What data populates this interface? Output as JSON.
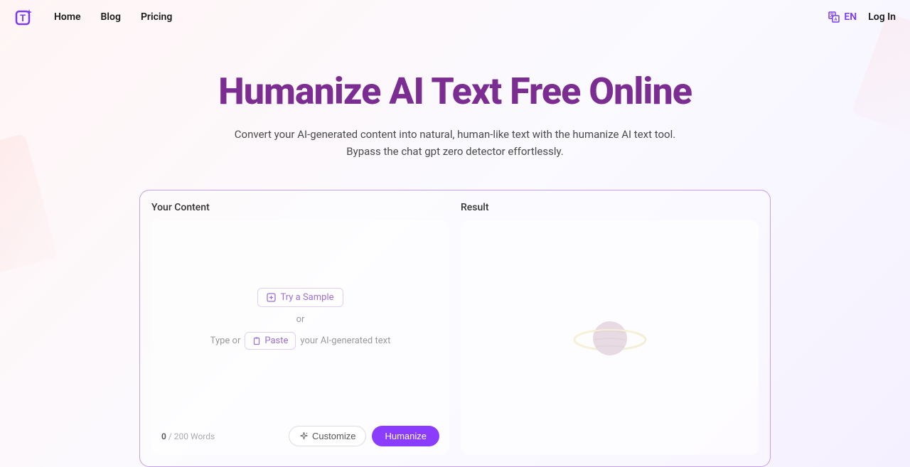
{
  "nav": {
    "home": "Home",
    "blog": "Blog",
    "pricing": "Pricing"
  },
  "header": {
    "lang": "EN",
    "login": "Log In"
  },
  "hero": {
    "title": "Humanize AI Text Free Online",
    "subtitle_line1": "Convert your AI-generated content into natural, human-like text with the humanize AI text tool.",
    "subtitle_line2": "Bypass the chat gpt zero detector effortlessly."
  },
  "panel": {
    "input_label": "Your Content",
    "result_label": "Result",
    "try_sample": "Try a Sample",
    "or": "or",
    "type_or": "Type or",
    "paste": "Paste",
    "your_ai_text": "your AI-generated text",
    "word_count_current": "0",
    "word_count_max": "/ 200 Words",
    "customize": "Customize",
    "humanize": "Humanize"
  }
}
